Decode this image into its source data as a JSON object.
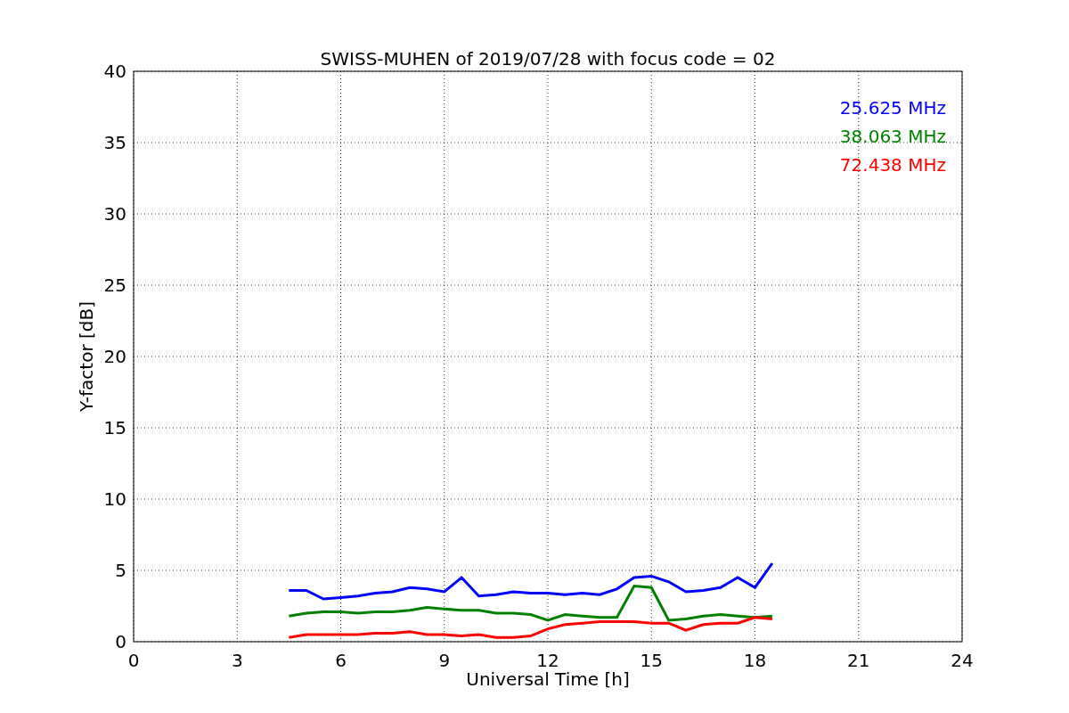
{
  "figure": {
    "chart_data": {
      "type": "line",
      "title": "SWISS-MUHEN of 2019/07/28 with focus code = 02",
      "xlabel": "Universal Time [h]",
      "ylabel": "Y-factor [dB]",
      "x": [
        4.5,
        5,
        5.5,
        6,
        6.5,
        7,
        7.5,
        8,
        8.5,
        9,
        9.5,
        10,
        10.5,
        11,
        11.5,
        12,
        12.5,
        13,
        13.5,
        14,
        14.5,
        15,
        15.5,
        16,
        16.5,
        17,
        17.5,
        18,
        18.5
      ],
      "series": [
        {
          "name": "25.625 MHz",
          "color": "#0000ff",
          "values": [
            3.6,
            3.6,
            3.0,
            3.1,
            3.2,
            3.4,
            3.5,
            3.8,
            3.7,
            3.5,
            4.5,
            3.2,
            3.3,
            3.5,
            3.4,
            3.4,
            3.3,
            3.4,
            3.3,
            3.7,
            4.5,
            4.6,
            4.2,
            3.5,
            3.6,
            3.8,
            4.5,
            3.8,
            5.5
          ]
        },
        {
          "name": "38.063 MHz",
          "color": "#008000",
          "values": [
            1.8,
            2.0,
            2.1,
            2.1,
            2.0,
            2.1,
            2.1,
            2.2,
            2.4,
            2.3,
            2.2,
            2.2,
            2.0,
            2.0,
            1.9,
            1.5,
            1.9,
            1.8,
            1.7,
            1.7,
            3.9,
            3.8,
            1.5,
            1.6,
            1.8,
            1.9,
            1.8,
            1.7,
            1.8
          ]
        },
        {
          "name": "72.438 MHz",
          "color": "#ff0000",
          "values": [
            0.3,
            0.5,
            0.5,
            0.5,
            0.5,
            0.6,
            0.6,
            0.7,
            0.5,
            0.5,
            0.4,
            0.5,
            0.3,
            0.3,
            0.4,
            0.9,
            1.2,
            1.3,
            1.4,
            1.4,
            1.4,
            1.3,
            1.3,
            0.8,
            1.2,
            1.3,
            1.3,
            1.7,
            1.6
          ]
        }
      ],
      "xlim": [
        0,
        24
      ],
      "ylim": [
        0,
        40
      ],
      "xticks": [
        0,
        3,
        6,
        9,
        12,
        15,
        18,
        21,
        24
      ],
      "yticks": [
        0,
        5,
        10,
        15,
        20,
        25,
        30,
        35,
        40
      ],
      "grid": true
    }
  }
}
